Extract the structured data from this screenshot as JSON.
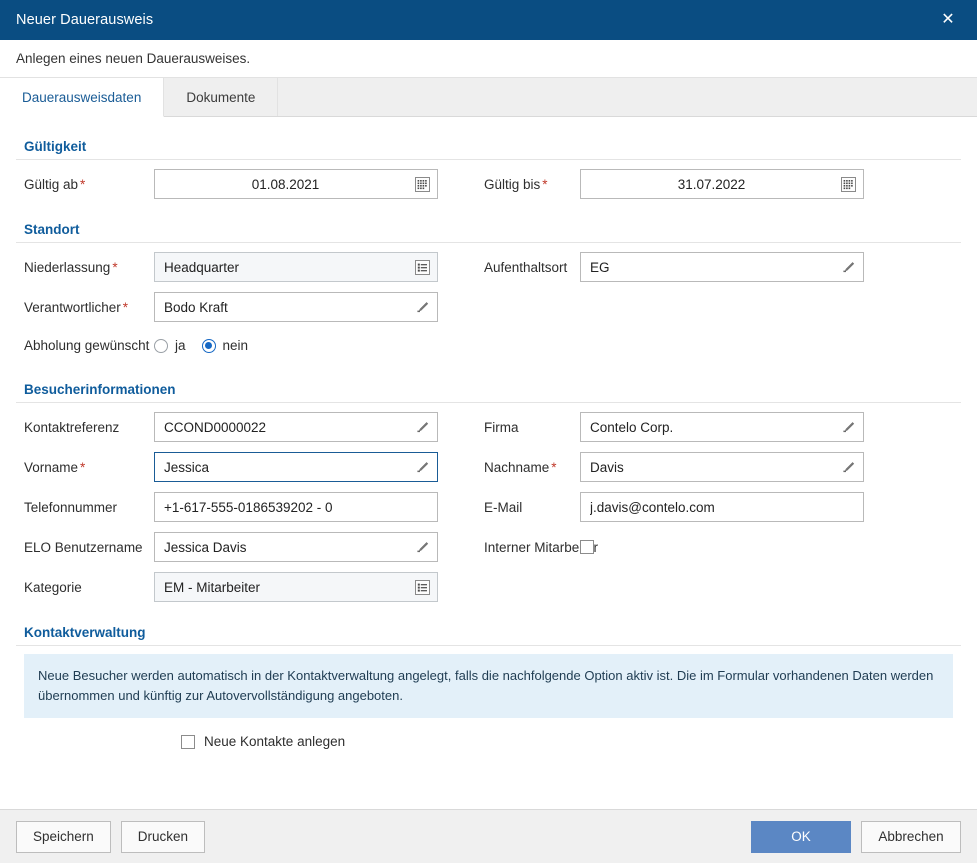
{
  "window": {
    "title": "Neuer Dauerausweis",
    "close_icon": "close-icon",
    "subtitle": "Anlegen eines neuen Dauerausweises."
  },
  "tabs": [
    {
      "label": "Dauerausweisdaten",
      "active": true
    },
    {
      "label": "Dokumente",
      "active": false
    }
  ],
  "sections": {
    "gueltigkeit": {
      "title": "Gültigkeit",
      "gueltig_ab": {
        "label": "Gültig ab",
        "required": "*",
        "value": "01.08.2021",
        "icon": "calendar-icon"
      },
      "gueltig_bis": {
        "label": "Gültig bis",
        "required": "*",
        "value": "31.07.2022",
        "icon": "calendar-icon"
      }
    },
    "standort": {
      "title": "Standort",
      "niederlassung": {
        "label": "Niederlassung",
        "required": "*",
        "value": "Headquarter",
        "icon": "list-select-icon"
      },
      "aufenthaltsort": {
        "label": "Aufenthaltsort",
        "required": "",
        "value": "EG",
        "icon": "pencil-icon"
      },
      "verantwortlicher": {
        "label": "Verantwortlicher",
        "required": "*",
        "value": "Bodo Kraft",
        "icon": "pencil-icon"
      },
      "abholung": {
        "label": "Abholung gewünscht",
        "options": [
          {
            "label": "ja",
            "selected": false
          },
          {
            "label": "nein",
            "selected": true
          }
        ]
      }
    },
    "besucher": {
      "title": "Besucherinformationen",
      "kontaktreferenz": {
        "label": "Kontaktreferenz",
        "required": "",
        "value": "CCOND0000022",
        "icon": "pencil-icon"
      },
      "firma": {
        "label": "Firma",
        "required": "",
        "value": "Contelo Corp.",
        "icon": "pencil-icon"
      },
      "vorname": {
        "label": "Vorname",
        "required": "*",
        "value": "Jessica",
        "icon": "pencil-icon"
      },
      "nachname": {
        "label": "Nachname",
        "required": "*",
        "value": "Davis",
        "icon": "pencil-icon"
      },
      "telefonnummer": {
        "label": "Telefonnummer",
        "required": "",
        "value": "+1-617-555-0186539202 - 0",
        "icon": ""
      },
      "email": {
        "label": "E-Mail",
        "required": "",
        "value": "j.davis@contelo.com",
        "icon": ""
      },
      "elo_benutzername": {
        "label": "ELO Benutzername",
        "required": "",
        "value": "Jessica Davis",
        "icon": "pencil-icon"
      },
      "interner_mitarbeiter": {
        "label": "Interner Mitarbeiter",
        "checked": false
      },
      "kategorie": {
        "label": "Kategorie",
        "required": "",
        "value": "EM - Mitarbeiter",
        "icon": "list-select-icon"
      }
    },
    "kontaktverwaltung": {
      "title": "Kontaktverwaltung",
      "info_text": "Neue Besucher werden automatisch in der Kontaktverwaltung angelegt, falls die nachfolgende Option aktiv ist. Die im Formular vorhandenen Daten werden übernommen und künftig zur Autovervollständigung angeboten.",
      "neue_kontakte": {
        "label": "Neue Kontakte anlegen",
        "checked": false
      }
    }
  },
  "footer": {
    "speichern": "Speichern",
    "drucken": "Drucken",
    "ok": "OK",
    "abbrechen": "Abbrechen"
  },
  "colors": {
    "titlebar": "#0a4d82",
    "section_heading": "#0f5c9c",
    "required_marker": "#c0392b",
    "primary_button": "#5b87c4",
    "info_box": "#e3f0f9",
    "radio_selected": "#1668c4",
    "focus_border": "#1a5c96"
  }
}
